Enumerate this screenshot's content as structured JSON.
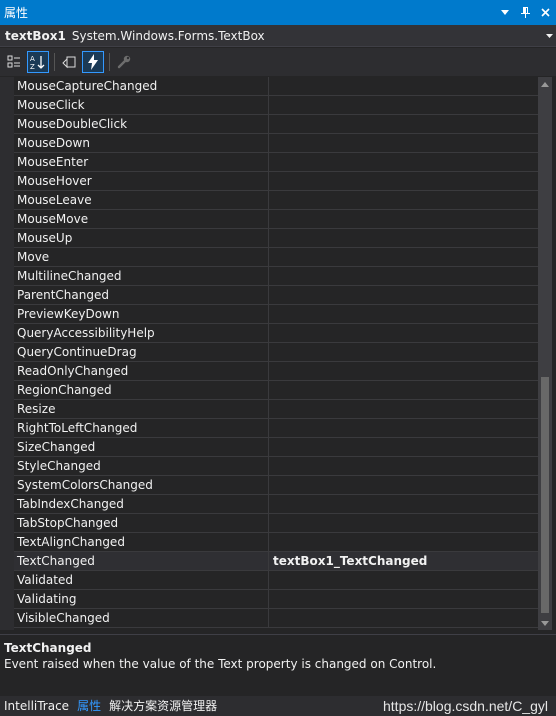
{
  "window": {
    "title": "属性"
  },
  "object_selector": {
    "name": "textBox1",
    "type": "System.Windows.Forms.TextBox"
  },
  "toolbar": {
    "buttons": [
      {
        "icon": "categorized-icon",
        "active": false
      },
      {
        "icon": "alphabetical-icon",
        "active": true
      },
      {
        "icon": "properties-icon",
        "active": false
      },
      {
        "icon": "events-icon",
        "active": true
      },
      {
        "icon": "property-pages-icon",
        "active": false
      }
    ]
  },
  "events": [
    {
      "name": "MouseCaptureChanged",
      "value": ""
    },
    {
      "name": "MouseClick",
      "value": ""
    },
    {
      "name": "MouseDoubleClick",
      "value": ""
    },
    {
      "name": "MouseDown",
      "value": ""
    },
    {
      "name": "MouseEnter",
      "value": ""
    },
    {
      "name": "MouseHover",
      "value": ""
    },
    {
      "name": "MouseLeave",
      "value": ""
    },
    {
      "name": "MouseMove",
      "value": ""
    },
    {
      "name": "MouseUp",
      "value": ""
    },
    {
      "name": "Move",
      "value": ""
    },
    {
      "name": "MultilineChanged",
      "value": ""
    },
    {
      "name": "ParentChanged",
      "value": ""
    },
    {
      "name": "PreviewKeyDown",
      "value": ""
    },
    {
      "name": "QueryAccessibilityHelp",
      "value": ""
    },
    {
      "name": "QueryContinueDrag",
      "value": ""
    },
    {
      "name": "ReadOnlyChanged",
      "value": ""
    },
    {
      "name": "RegionChanged",
      "value": ""
    },
    {
      "name": "Resize",
      "value": ""
    },
    {
      "name": "RightToLeftChanged",
      "value": ""
    },
    {
      "name": "SizeChanged",
      "value": ""
    },
    {
      "name": "StyleChanged",
      "value": ""
    },
    {
      "name": "SystemColorsChanged",
      "value": ""
    },
    {
      "name": "TabIndexChanged",
      "value": ""
    },
    {
      "name": "TabStopChanged",
      "value": ""
    },
    {
      "name": "TextAlignChanged",
      "value": ""
    },
    {
      "name": "TextChanged",
      "value": "textBox1_TextChanged",
      "selected": true
    },
    {
      "name": "Validated",
      "value": ""
    },
    {
      "name": "Validating",
      "value": ""
    },
    {
      "name": "VisibleChanged",
      "value": ""
    }
  ],
  "description": {
    "title": "TextChanged",
    "text": "Event raised when the value of the Text property is changed on Control."
  },
  "tabs": [
    {
      "label": "IntelliTrace",
      "active": false
    },
    {
      "label": "属性",
      "active": true
    },
    {
      "label": "解决方案资源管理器",
      "active": false
    }
  ],
  "watermark": "https://blog.csdn.net/C_gyl",
  "colors": {
    "accent": "#007acc",
    "background": "#252526",
    "selection_border": "#3399ff"
  }
}
